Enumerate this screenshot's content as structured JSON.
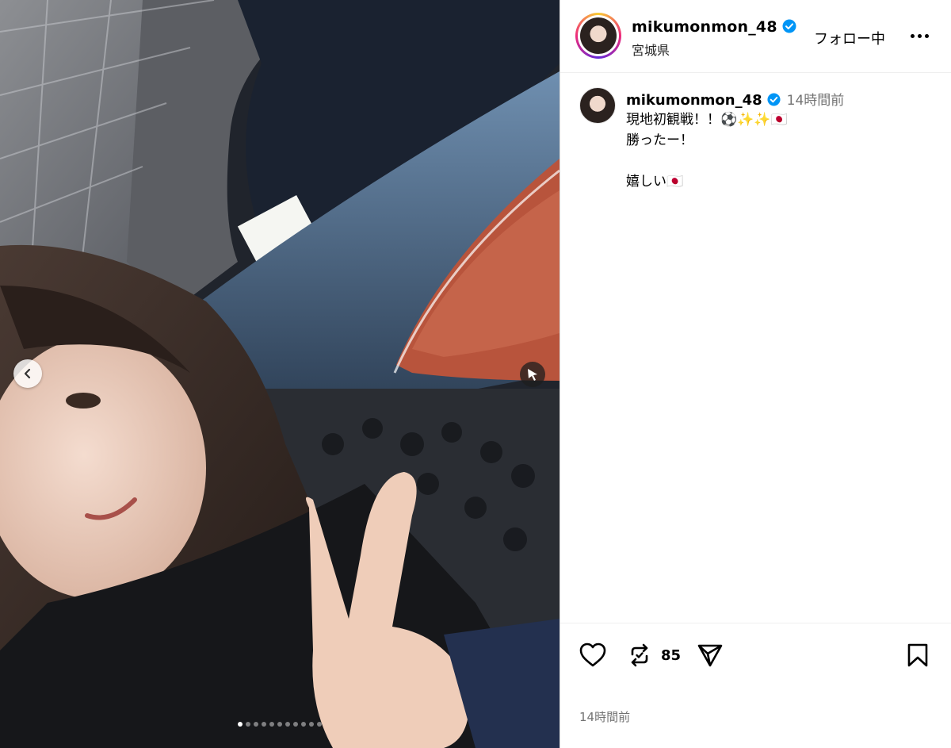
{
  "header": {
    "username": "mikumonmon_48",
    "location": "宮城県",
    "follow_state": "フォロー中"
  },
  "caption": {
    "username": "mikumonmon_48",
    "time": "14時間前",
    "text": "現地初観戦！！⚽✨✨🇯🇵\n勝ったー！\n\n嬉しい🇯🇵"
  },
  "actions": {
    "repost_count": "85"
  },
  "footer": {
    "timestamp": "14時間前"
  },
  "carousel": {
    "total": 11,
    "active_index": 0
  },
  "colors": {
    "verified": "#0095f6",
    "secondary_text": "#737373",
    "divider": "#dbdbdb"
  }
}
